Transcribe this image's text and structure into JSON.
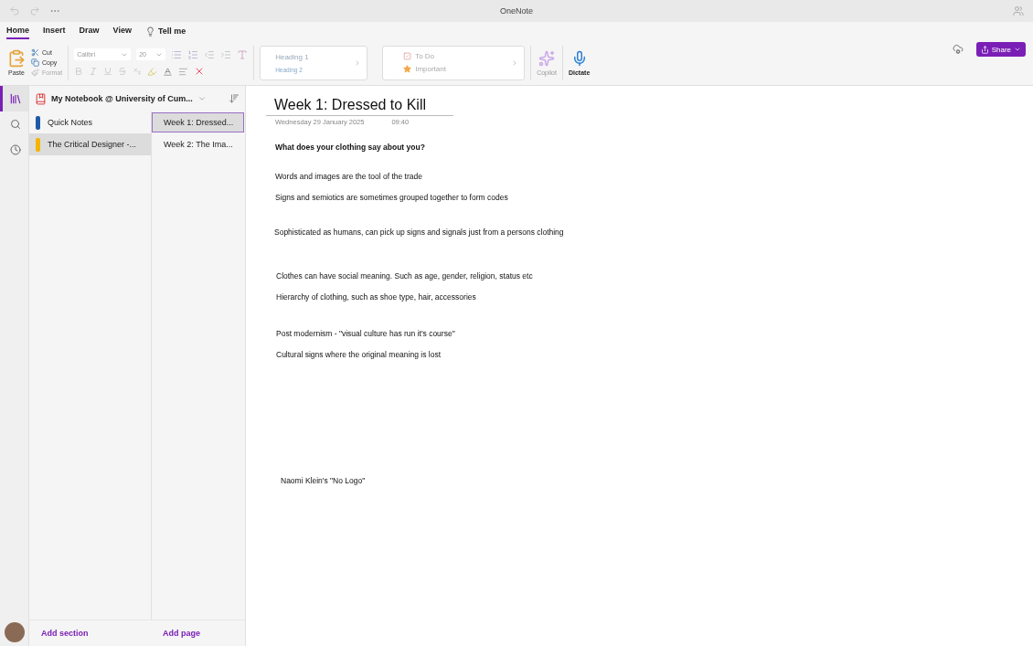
{
  "window": {
    "title": "OneNote"
  },
  "tabs": [
    {
      "label": "Home",
      "selected": true
    },
    {
      "label": "Insert",
      "selected": false
    },
    {
      "label": "Draw",
      "selected": false
    },
    {
      "label": "View",
      "selected": false
    }
  ],
  "tell_me": {
    "label": "Tell me"
  },
  "ribbon": {
    "paste": {
      "label": "Paste"
    },
    "clipboard": [
      {
        "label": "Cut",
        "disabled": false
      },
      {
        "label": "Copy",
        "disabled": false
      },
      {
        "label": "Format",
        "disabled": true
      }
    ],
    "font": {
      "value": "Calibri"
    },
    "size": {
      "value": "20"
    },
    "styles": [
      {
        "label": "Heading 1"
      },
      {
        "label": "Heading 2"
      }
    ],
    "tags": [
      {
        "label": "To Do"
      },
      {
        "label": "Important"
      }
    ],
    "copilot": {
      "label": "Copilot",
      "disabled": true
    },
    "dictate": {
      "label": "Dictate",
      "disabled": false
    },
    "share": {
      "label": "Share"
    }
  },
  "notebook": {
    "title": "My Notebook @ University of Cum..."
  },
  "sections": [
    {
      "label": "Quick Notes",
      "color": "#1f5aa6",
      "selected": false
    },
    {
      "label": "The Critical Designer -...",
      "color": "#f4b400",
      "selected": true
    }
  ],
  "pages": [
    {
      "label": "Week 1: Dressed...",
      "selected": true
    },
    {
      "label": "Week 2: The Ima...",
      "selected": false
    }
  ],
  "add_section": "Add section",
  "add_page": "Add page",
  "page": {
    "title": "Week 1: Dressed to Kill",
    "date": "Wednesday 29 January 2025",
    "time": "09:40",
    "blocks": [
      [
        {
          "text": "What does your clothing say about you?",
          "bold": true
        }
      ],
      [
        {
          "text": "Words and images are the tool of the trade",
          "bold": false
        },
        {
          "text": "Signs and semiotics are sometimes grouped together to form codes",
          "bold": false
        }
      ],
      [
        {
          "text": "Sophisticated as humans, can pick up signs and signals just from a persons clothing",
          "bold": false
        }
      ],
      [
        {
          "text": "Clothes can have social meaning. Such as age, gender, religion, status etc",
          "bold": false
        },
        {
          "text": "Hierarchy of clothing, such as shoe type, hair, accessories",
          "bold": false
        }
      ],
      [
        {
          "text": "Post modernism - \"visual culture has run it's course\"",
          "bold": false
        },
        {
          "text": "Cultural signs where the original meaning is lost",
          "bold": false
        }
      ],
      [
        {
          "text": "Naomi Klein's \"No Logo\"",
          "bold": false
        }
      ]
    ]
  }
}
